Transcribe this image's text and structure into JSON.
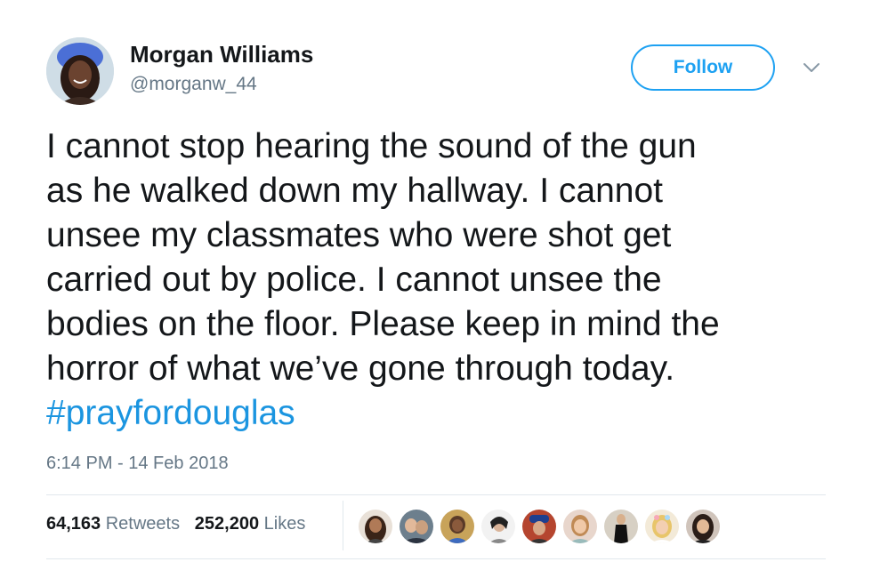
{
  "user": {
    "display_name": "Morgan Williams",
    "handle": "@morganw_44",
    "avatar_icon": "profile-photo"
  },
  "follow_label": "Follow",
  "menu_icon": "chevron-down-icon",
  "tweet": {
    "lines": [
      "I cannot stop hearing the sound of the gun",
      "as he walked down my hallway. I cannot",
      "unsee my classmates who were shot get",
      "carried out by police. I cannot unsee the",
      "bodies on the floor. Please keep in mind the",
      "horror of what we’ve gone through today."
    ],
    "hashtag": "#prayfordouglas"
  },
  "timestamp": "6:14 PM - 14 Feb 2018",
  "stats": {
    "retweets_count": "64,163",
    "retweets_label": "Retweets",
    "likes_count": "252,200",
    "likes_label": "Likes"
  },
  "colors": {
    "accent": "#1da1f2",
    "hashtag": "#1b95e0",
    "text": "#14171a",
    "muted": "#657786",
    "divider": "#e1e8ed"
  }
}
